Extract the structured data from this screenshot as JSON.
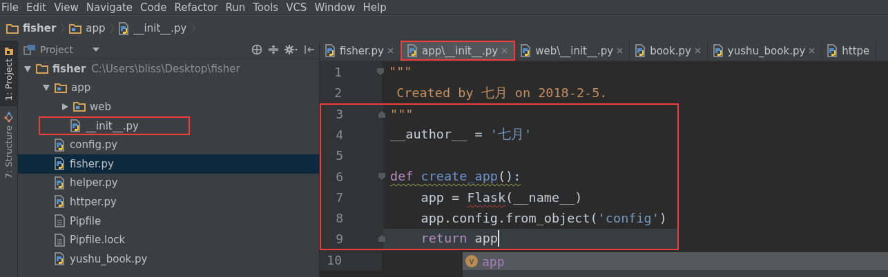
{
  "menu": [
    "File",
    "Edit",
    "View",
    "Navigate",
    "Code",
    "Refactor",
    "Run",
    "Tools",
    "VCS",
    "Window",
    "Help"
  ],
  "breadcrumbs": [
    {
      "label": "fisher",
      "kind": "folder"
    },
    {
      "label": "app",
      "kind": "package"
    },
    {
      "label": "__init__.py",
      "kind": "python"
    }
  ],
  "tool_strip": [
    {
      "label": "1: Project",
      "kind": "project",
      "selected": true
    },
    {
      "label": "7: Structure",
      "kind": "structure",
      "selected": false
    }
  ],
  "project_panel": {
    "title": "Project",
    "tree": [
      {
        "label": "fisher",
        "path": "C:\\Users\\bliss\\Desktop\\fisher",
        "kind": "folder",
        "expanded": true,
        "selected": false,
        "highlighted": false,
        "children": [
          {
            "label": "app",
            "kind": "package",
            "expanded": true,
            "selected": false,
            "highlighted": false,
            "children": [
              {
                "label": "web",
                "kind": "package",
                "expanded": false,
                "selected": false,
                "highlighted": false
              },
              {
                "label": "__init__.py",
                "kind": "python",
                "selected": false,
                "highlighted": true
              }
            ]
          },
          {
            "label": "config.py",
            "kind": "python",
            "selected": false,
            "highlighted": false
          },
          {
            "label": "fisher.py",
            "kind": "python",
            "selected": true,
            "highlighted": false
          },
          {
            "label": "helper.py",
            "kind": "python",
            "selected": false,
            "highlighted": false
          },
          {
            "label": "httper.py",
            "kind": "python",
            "selected": false,
            "highlighted": false
          },
          {
            "label": "Pipfile",
            "kind": "text",
            "selected": false,
            "highlighted": false
          },
          {
            "label": "Pipfile.lock",
            "kind": "text",
            "selected": false,
            "highlighted": false
          },
          {
            "label": "yushu_book.py",
            "kind": "python",
            "selected": false,
            "highlighted": false
          }
        ]
      }
    ]
  },
  "editor_tabs": [
    {
      "label": "fisher.py",
      "selected": false,
      "highlighted": false,
      "closable": true
    },
    {
      "label": "app\\__init__.py",
      "selected": true,
      "highlighted": true,
      "closable": true
    },
    {
      "label": "web\\__init__.py",
      "selected": false,
      "highlighted": false,
      "closable": true
    },
    {
      "label": "book.py",
      "selected": false,
      "highlighted": false,
      "closable": true
    },
    {
      "label": "yushu_book.py",
      "selected": false,
      "highlighted": false,
      "closable": true
    },
    {
      "label": "httpe",
      "selected": false,
      "highlighted": false,
      "closable": false
    }
  ],
  "code_lines": [
    {
      "number": "1",
      "kind": "fold_start",
      "current": false,
      "highlighted": false,
      "warning": false,
      "tokens": [
        {
          "kind": "doc",
          "text": "\"\"\"",
          "error": false
        }
      ]
    },
    {
      "number": "2",
      "kind": "plain",
      "current": false,
      "highlighted": false,
      "warning": false,
      "tokens": [
        {
          "kind": "doc",
          "text": " Created by 七月 on 2018-2-5.",
          "error": false
        }
      ]
    },
    {
      "number": "3",
      "kind": "fold_end",
      "current": false,
      "highlighted": true,
      "warning": false,
      "tokens": [
        {
          "kind": "doc",
          "text": "\"\"\"",
          "error": false
        }
      ]
    },
    {
      "number": "4",
      "kind": "plain",
      "current": false,
      "highlighted": true,
      "warning": false,
      "tokens": [
        {
          "kind": "plain",
          "text": "__author__ = ",
          "error": false
        },
        {
          "kind": "string",
          "text": "'七月'",
          "error": false
        }
      ]
    },
    {
      "number": "5",
      "kind": "plain",
      "current": false,
      "highlighted": true
    },
    {
      "number": "6",
      "kind": "fold_start",
      "current": false,
      "highlighted": true,
      "warning": true,
      "tokens": [
        {
          "kind": "keyword",
          "text": "def ",
          "error": false
        },
        {
          "kind": "func",
          "text": "create_app",
          "error": false
        },
        {
          "kind": "plain",
          "text": "():",
          "error": false
        }
      ]
    },
    {
      "number": "7",
      "kind": "plain",
      "current": false,
      "highlighted": true,
      "warning": false,
      "tokens": [
        {
          "kind": "plain",
          "text": "    app = ",
          "error": false
        },
        {
          "kind": "plain",
          "text": "Flask",
          "error": true
        },
        {
          "kind": "plain",
          "text": "(__name__)",
          "error": false
        }
      ]
    },
    {
      "number": "8",
      "kind": "plain",
      "current": false,
      "highlighted": true,
      "warning": false,
      "tokens": [
        {
          "kind": "plain",
          "text": "    app.config.from_object(",
          "error": false
        },
        {
          "kind": "string",
          "text": "'config'",
          "error": false
        },
        {
          "kind": "plain",
          "text": ")",
          "error": false
        }
      ]
    },
    {
      "number": "9",
      "kind": "fold_end",
      "current": true,
      "highlighted": true,
      "warning": false,
      "tokens": [
        {
          "kind": "keyword",
          "text": "    return ",
          "error": false
        },
        {
          "kind": "plain",
          "text": "app",
          "error": false
        }
      ]
    },
    {
      "number": "10",
      "kind": "plain",
      "current": false,
      "highlighted": false
    }
  ],
  "completion": {
    "items": [
      {
        "badge": "v",
        "label": "app",
        "selected": true
      }
    ]
  }
}
